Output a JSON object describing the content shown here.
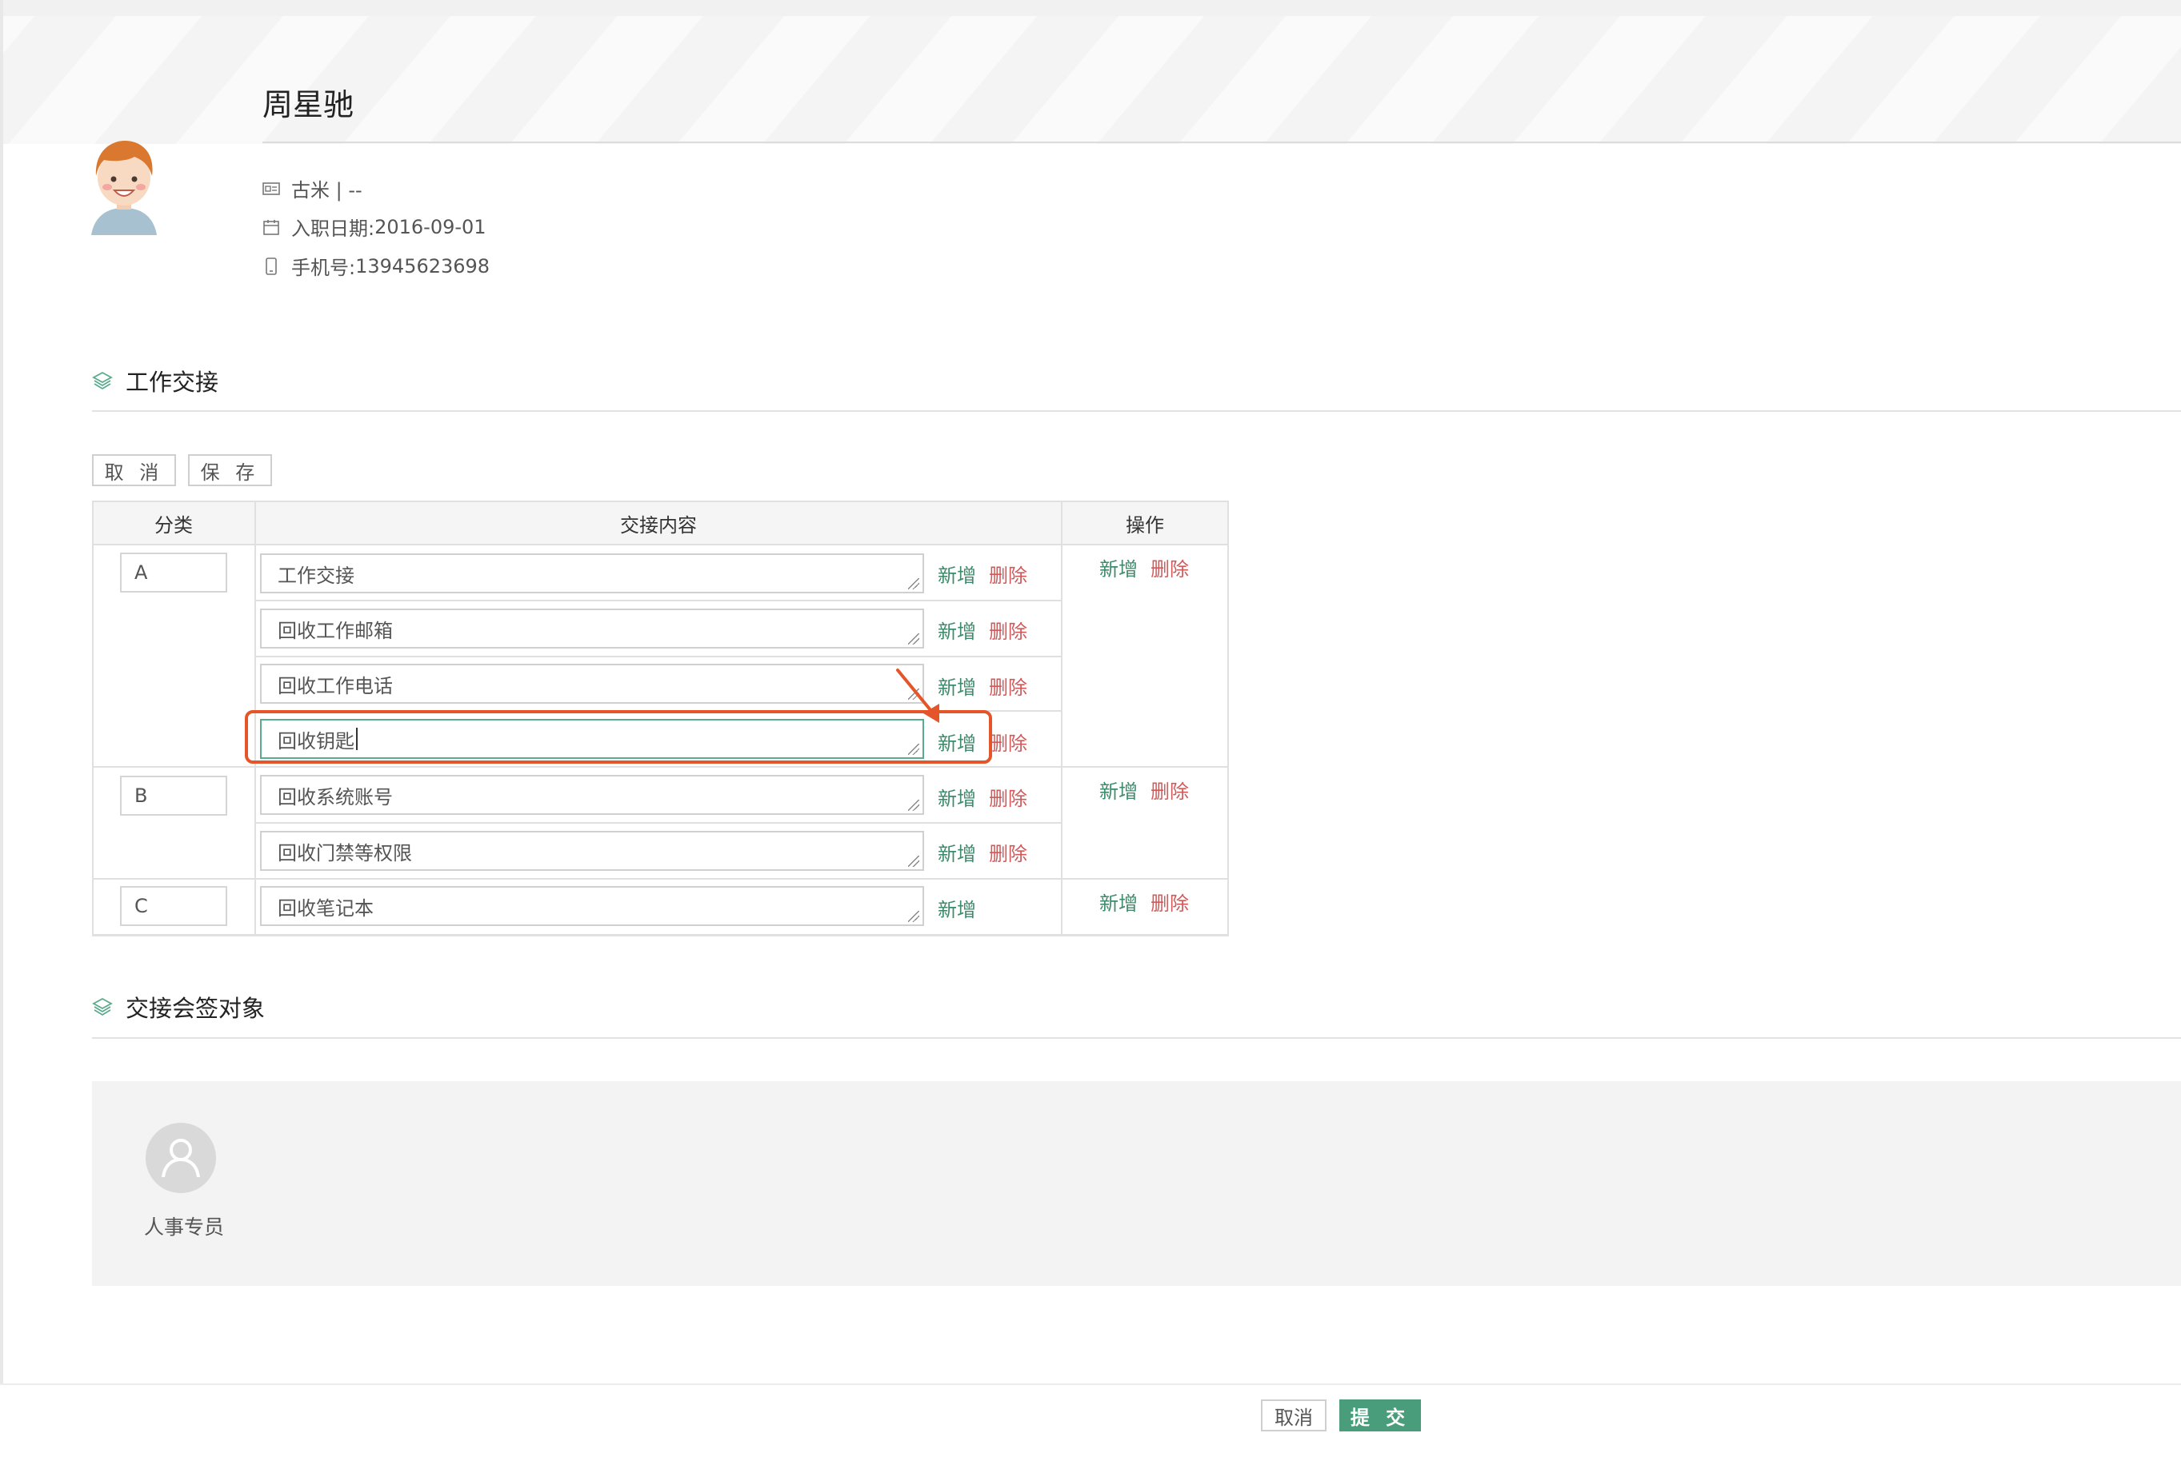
{
  "employee": {
    "name": "周星驰",
    "org": "古米 | --",
    "hire_label": "入职日期:",
    "hire_date": "2016-09-01",
    "phone_label": "手机号:",
    "phone": "13945623698"
  },
  "sections": {
    "handover_title": "工作交接",
    "signers_title": "交接会签对象"
  },
  "toolbar": {
    "cancel_label": "取 消",
    "save_label": "保 存"
  },
  "table": {
    "headers": [
      "分类",
      "交接内容",
      "操作"
    ],
    "add_label": "新增",
    "delete_label": "删除",
    "groups": [
      {
        "category": "A",
        "items": [
          "工作交接",
          "回收工作邮箱",
          "回收工作电话",
          "回收钥匙"
        ]
      },
      {
        "category": "B",
        "items": [
          "回收系统账号",
          "回收门禁等权限"
        ]
      },
      {
        "category": "C",
        "items": [
          "回收笔记本"
        ]
      }
    ]
  },
  "signers": [
    {
      "name": "人事专员"
    }
  ],
  "footer": {
    "cancel_label": "取消",
    "submit_label": "提 交"
  },
  "colors": {
    "accent": "#4a9d7b",
    "link_green": "#3d8b6b",
    "delete_red": "#d05a5a",
    "annotation": "#e5552a"
  },
  "icons": [
    "id-card-icon",
    "calendar-icon",
    "phone-icon",
    "layers-icon",
    "user-icon",
    "arrow-annotation-icon"
  ]
}
